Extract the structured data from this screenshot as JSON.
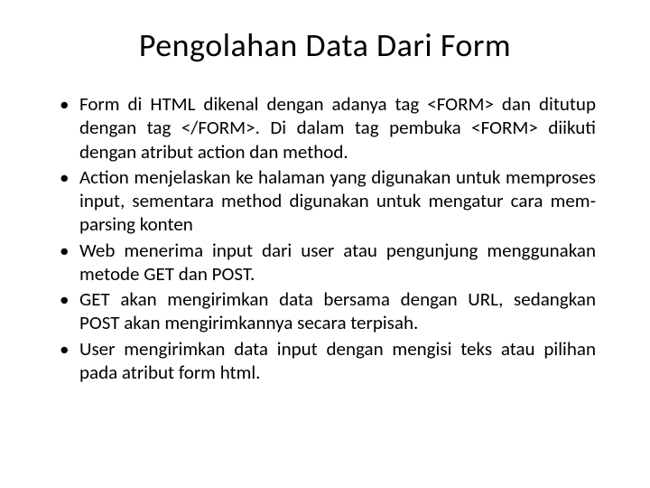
{
  "slide": {
    "title": "Pengolahan Data Dari Form",
    "bullets": [
      "Form di HTML dikenal dengan adanya tag <FORM> dan ditutup dengan tag </FORM>. Di dalam tag pembuka <FORM> diikuti dengan atribut action dan method.",
      "Action menjelaskan ke halaman yang digunakan untuk memproses input, sementara method digunakan untuk mengatur cara mem-parsing konten",
      "Web menerima input dari user atau pengunjung menggunakan metode GET dan POST.",
      "GET akan mengirimkan data bersama dengan URL, sedangkan POST akan mengirimkannya secara terpisah.",
      "User mengirimkan data input dengan mengisi teks atau pilihan pada atribut form html."
    ]
  }
}
